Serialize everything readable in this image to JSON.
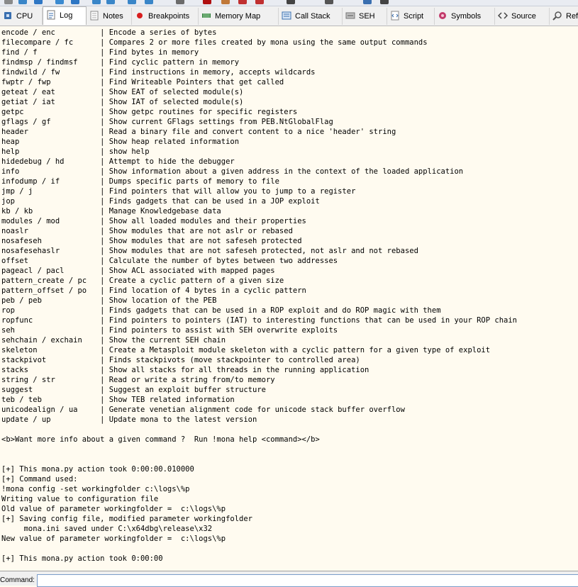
{
  "tabs": [
    {
      "id": "cpu",
      "label": "CPU",
      "active": false
    },
    {
      "id": "log",
      "label": "Log",
      "active": true
    },
    {
      "id": "notes",
      "label": "Notes",
      "active": false
    },
    {
      "id": "breakpoints",
      "label": "Breakpoints",
      "active": false
    },
    {
      "id": "memory-map",
      "label": "Memory Map",
      "active": false
    },
    {
      "id": "call-stack",
      "label": "Call Stack",
      "active": false
    },
    {
      "id": "seh",
      "label": "SEH",
      "active": false
    },
    {
      "id": "script",
      "label": "Script",
      "active": false
    },
    {
      "id": "symbols",
      "label": "Symbols",
      "active": false
    },
    {
      "id": "source",
      "label": "Source",
      "active": false
    },
    {
      "id": "references",
      "label": "Ref",
      "active": false
    }
  ],
  "log": {
    "commands": [
      {
        "cmd": "encode / enc",
        "desc": "Encode a series of bytes"
      },
      {
        "cmd": "filecompare / fc",
        "desc": "Compares 2 or more files created by mona using the same output commands"
      },
      {
        "cmd": "find / f",
        "desc": "Find bytes in memory"
      },
      {
        "cmd": "findmsp / findmsf",
        "desc": "Find cyclic pattern in memory"
      },
      {
        "cmd": "findwild / fw",
        "desc": "Find instructions in memory, accepts wildcards"
      },
      {
        "cmd": "fwptr / fwp",
        "desc": "Find Writeable Pointers that get called"
      },
      {
        "cmd": "geteat / eat",
        "desc": "Show EAT of selected module(s)"
      },
      {
        "cmd": "getiat / iat",
        "desc": "Show IAT of selected module(s)"
      },
      {
        "cmd": "getpc",
        "desc": "Show getpc routines for specific registers"
      },
      {
        "cmd": "gflags / gf",
        "desc": "Show current GFlags settings from PEB.NtGlobalFlag"
      },
      {
        "cmd": "header",
        "desc": "Read a binary file and convert content to a nice 'header' string"
      },
      {
        "cmd": "heap",
        "desc": "Show heap related information"
      },
      {
        "cmd": "help",
        "desc": "show help"
      },
      {
        "cmd": "hidedebug / hd",
        "desc": "Attempt to hide the debugger"
      },
      {
        "cmd": "info",
        "desc": "Show information about a given address in the context of the loaded application"
      },
      {
        "cmd": "infodump / if",
        "desc": "Dumps specific parts of memory to file"
      },
      {
        "cmd": "jmp / j",
        "desc": "Find pointers that will allow you to jump to a register"
      },
      {
        "cmd": "jop",
        "desc": "Finds gadgets that can be used in a JOP exploit"
      },
      {
        "cmd": "kb / kb",
        "desc": "Manage Knowledgebase data"
      },
      {
        "cmd": "modules / mod",
        "desc": "Show all loaded modules and their properties"
      },
      {
        "cmd": "noaslr",
        "desc": "Show modules that are not aslr or rebased"
      },
      {
        "cmd": "nosafeseh",
        "desc": "Show modules that are not safeseh protected"
      },
      {
        "cmd": "nosafesehaslr",
        "desc": "Show modules that are not safeseh protected, not aslr and not rebased"
      },
      {
        "cmd": "offset",
        "desc": "Calculate the number of bytes between two addresses"
      },
      {
        "cmd": "pageacl / pacl",
        "desc": "Show ACL associated with mapped pages"
      },
      {
        "cmd": "pattern_create / pc",
        "desc": "Create a cyclic pattern of a given size"
      },
      {
        "cmd": "pattern_offset / po",
        "desc": "Find location of 4 bytes in a cyclic pattern"
      },
      {
        "cmd": "peb / peb",
        "desc": "Show location of the PEB"
      },
      {
        "cmd": "rop",
        "desc": "Finds gadgets that can be used in a ROP exploit and do ROP magic with them"
      },
      {
        "cmd": "ropfunc",
        "desc": "Find pointers to pointers (IAT) to interesting functions that can be used in your ROP chain"
      },
      {
        "cmd": "seh",
        "desc": "Find pointers to assist with SEH overwrite exploits"
      },
      {
        "cmd": "sehchain / exchain",
        "desc": "Show the current SEH chain"
      },
      {
        "cmd": "skeleton",
        "desc": "Create a Metasploit module skeleton with a cyclic pattern for a given type of exploit"
      },
      {
        "cmd": "stackpivot",
        "desc": "Finds stackpivots (move stackpointer to controlled area)"
      },
      {
        "cmd": "stacks",
        "desc": "Show all stacks for all threads in the running application"
      },
      {
        "cmd": "string / str",
        "desc": "Read or write a string from/to memory"
      },
      {
        "cmd": "suggest",
        "desc": "Suggest an exploit buffer structure"
      },
      {
        "cmd": "teb / teb",
        "desc": "Show TEB related information"
      },
      {
        "cmd": "unicodealign / ua",
        "desc": "Generate venetian alignment code for unicode stack buffer overflow"
      },
      {
        "cmd": "update / up",
        "desc": "Update mona to the latest version"
      }
    ],
    "trailer": [
      "",
      "<b>Want more info about a given command ?  Run !mona help <command></b>",
      "",
      "",
      "[+] This mona.py action took 0:00:00.010000",
      "[+] Command used:",
      "!mona config -set workingfolder c:\\logs\\%p",
      "Writing value to configuration file",
      "Old value of parameter workingfolder =  c:\\logs\\%p",
      "[+] Saving config file, modified parameter workingfolder",
      "     mona.ini saved under C:\\x64dbg\\release\\x32",
      "New value of parameter workingfolder =  c:\\logs\\%p",
      "",
      "[+] This mona.py action took 0:00:00"
    ]
  },
  "command_bar": {
    "label": "Command:",
    "value": "",
    "placeholder": ""
  }
}
